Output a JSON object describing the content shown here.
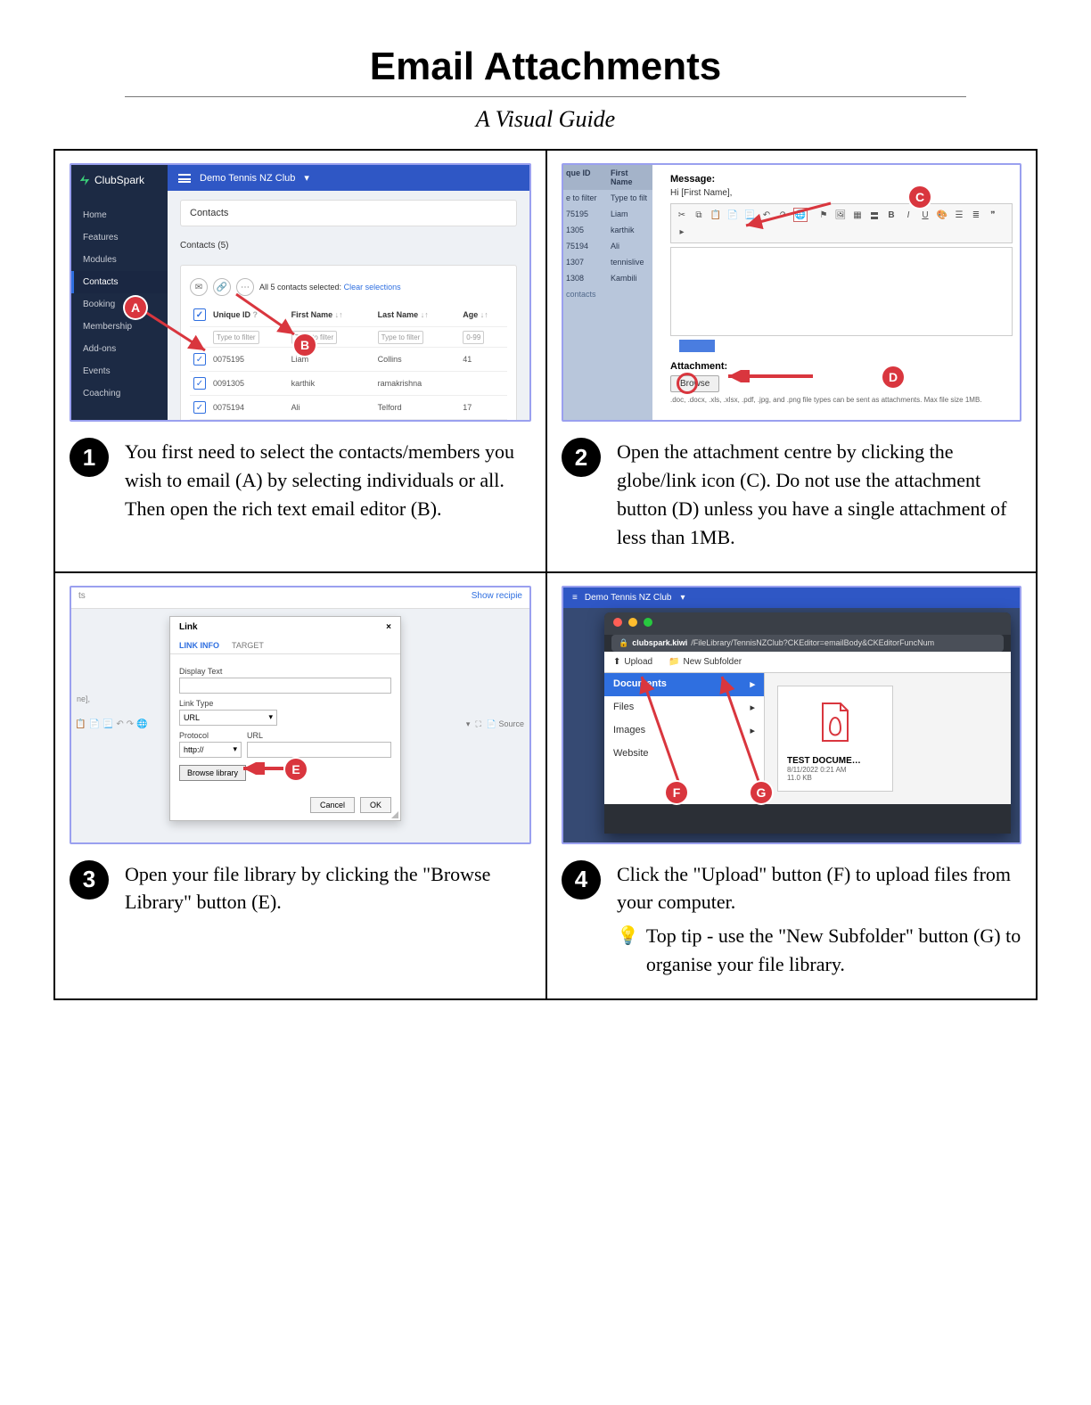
{
  "title": "Email Attachments",
  "subtitle": "A Visual Guide",
  "markers": {
    "A": "A",
    "B": "B",
    "C": "C",
    "D": "D",
    "E": "E",
    "F": "F",
    "G": "G"
  },
  "step1": {
    "num": "1",
    "text": "You first need to select the contacts/members you wish to email (A) by selecting individuals or all. Then open the rich text email editor (B).",
    "shot": {
      "logo": "ClubSpark",
      "club": "Demo Tennis NZ Club",
      "sidebar": [
        "Home",
        "Features",
        "Modules",
        "Contacts",
        "Booking",
        "Membership",
        "Add-ons",
        "Events",
        "Coaching"
      ],
      "header1": "Contacts",
      "header2": "Contacts (5)",
      "selected_text": "All 5 contacts selected:",
      "clear": "Clear selections",
      "cols": {
        "id": "Unique ID",
        "fn": "First Name",
        "ln": "Last Name",
        "age": "Age"
      },
      "filter_ph": "Type to filter",
      "age_ph": "0-99",
      "rows": [
        {
          "id": "0075195",
          "fn": "Liam",
          "ln": "Collins",
          "age": "41"
        },
        {
          "id": "0091305",
          "fn": "karthik",
          "ln": "ramakrishna",
          "age": ""
        },
        {
          "id": "0075194",
          "fn": "Ali",
          "ln": "Telford",
          "age": "17"
        }
      ]
    }
  },
  "step2": {
    "num": "2",
    "text": "Open the attachment centre by clicking the globe/link icon (C). Do not use the attachment button (D) unless you have a single attachment of less than 1MB.",
    "shot": {
      "cols": {
        "id": "que ID",
        "fn": "First Name"
      },
      "id_filter": "e to filter",
      "fn_filter": "Type to filt",
      "rows": [
        {
          "id": "75195",
          "fn": "Liam"
        },
        {
          "id": "1305",
          "fn": "karthik"
        },
        {
          "id": "75194",
          "fn": "Ali"
        },
        {
          "id": "1307",
          "fn": "tennislive"
        },
        {
          "id": "1308",
          "fn": "Kambili"
        }
      ],
      "contacts_foot": "contacts",
      "msg_label": "Message:",
      "hi": "Hi [First Name],",
      "attach_label": "Attachment:",
      "browse": "Browse",
      "note": ".doc, .docx, .xls, .xlsx, .pdf, .jpg, and .png file types can be sent as attachments. Max file size 1MB."
    }
  },
  "step3": {
    "num": "3",
    "text": "Open your file library by clicking the \"Browse Library\" button (E).",
    "shot": {
      "top_left": "ts",
      "top_right": "Show recipie",
      "bg_left": "ne],",
      "dialog_title": "Link",
      "tab1": "LINK INFO",
      "tab2": "TARGET",
      "display_text": "Display Text",
      "link_type": "Link Type",
      "link_type_val": "URL",
      "protocol": "Protocol",
      "protocol_val": "http://",
      "url": "URL",
      "browse": "Browse library",
      "cancel": "Cancel",
      "ok": "OK",
      "source": "Source"
    }
  },
  "step4": {
    "num": "4",
    "text": "Click the \"Upload\" button (F) to upload files from your computer.",
    "tip": "Top tip - use the \"New Subfolder\" button (G) to organise your file library.",
    "shot": {
      "club": "Demo Tennis NZ Club",
      "url_host": "clubspark.kiwi",
      "url_rest": "/FileLibrary/TennisNZClub?CKEditor=emailBody&CKEditorFuncNum",
      "upload": "Upload",
      "new_sub": "New Subfolder",
      "tree": [
        "Documents",
        "Files",
        "Images",
        "Website"
      ],
      "file": {
        "name": "TEST DOCUME…",
        "date": "8/11/2022 0:21 AM",
        "size": "11.0 KB"
      }
    }
  }
}
